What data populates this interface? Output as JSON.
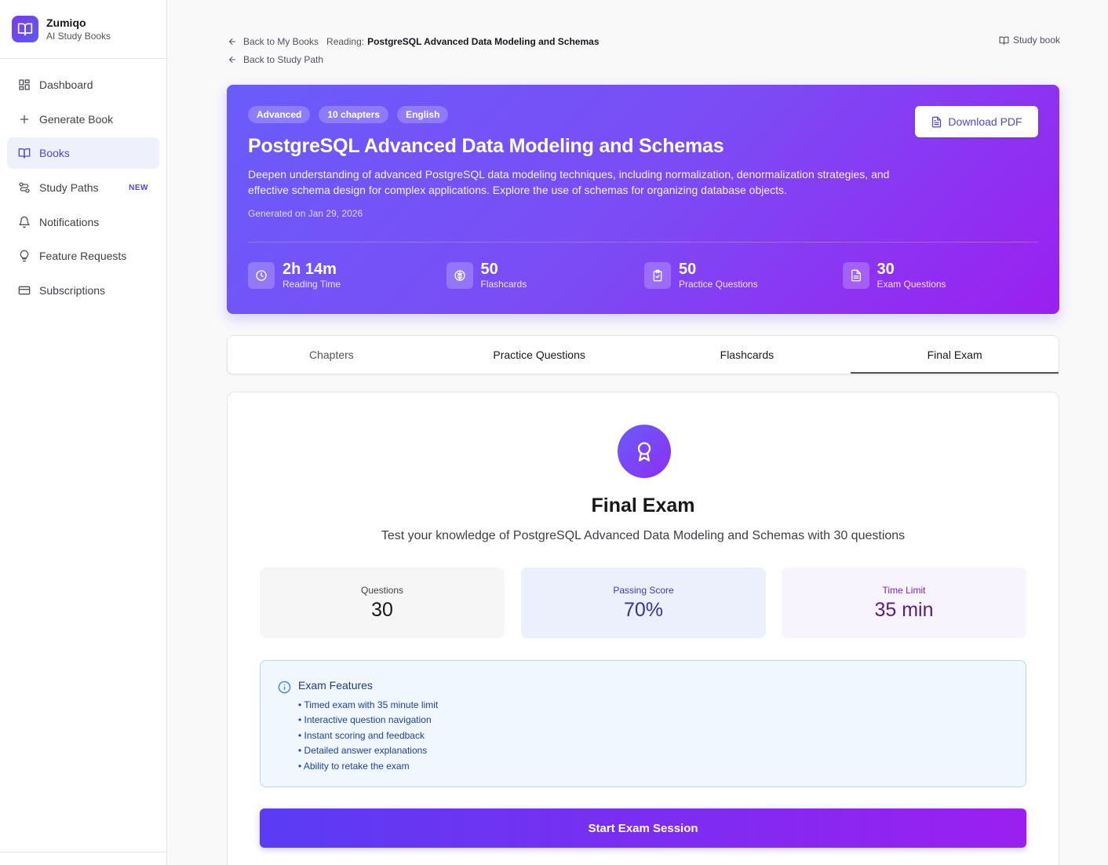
{
  "brand": {
    "name": "Zumiqo",
    "subtitle": "AI Study Books"
  },
  "sidebar": {
    "items": [
      {
        "label": "Dashboard",
        "icon": "dashboard-icon"
      },
      {
        "label": "Generate Book",
        "icon": "plus-icon"
      },
      {
        "label": "Books",
        "icon": "book-open-icon",
        "active": true
      },
      {
        "label": "Study Paths",
        "icon": "route-icon",
        "badge": "NEW"
      },
      {
        "label": "Notifications",
        "icon": "bell-icon"
      },
      {
        "label": "Feature Requests",
        "icon": "lightbulb-icon"
      },
      {
        "label": "Subscriptions",
        "icon": "credit-card-icon"
      }
    ]
  },
  "breadcrumbs": {
    "back_to_books": "Back to My Books",
    "reading_label": "Reading:",
    "book_name": "PostgreSQL Advanced Data Modeling and Schemas",
    "back_to_path": "Back to Study Path",
    "study_book": "Study book"
  },
  "hero": {
    "tags": [
      "Advanced",
      "10 chapters",
      "English"
    ],
    "title": "PostgreSQL Advanced Data Modeling and Schemas",
    "description": "Deepen understanding of advanced PostgreSQL data modeling techniques, including normalization, denormalization strategies, and effective schema design for complex applications. Explore the use of schemas for organizing database objects.",
    "generated": "Generated on Jan 29, 2026",
    "download_label": "Download PDF",
    "stats": [
      {
        "value": "2h 14m",
        "label": "Reading Time",
        "icon": "clock-icon"
      },
      {
        "value": "50",
        "label": "Flashcards",
        "icon": "brain-icon"
      },
      {
        "value": "50",
        "label": "Practice Questions",
        "icon": "clipboard-check-icon"
      },
      {
        "value": "30",
        "label": "Exam Questions",
        "icon": "file-text-icon"
      }
    ]
  },
  "tabs": [
    {
      "label": "Chapters"
    },
    {
      "label": "Practice Questions"
    },
    {
      "label": "Flashcards"
    },
    {
      "label": "Final Exam",
      "active": true
    }
  ],
  "exam": {
    "title": "Final Exam",
    "subtitle": "Test your knowledge of PostgreSQL Advanced Data Modeling and Schemas with 30 questions",
    "metrics": [
      {
        "label": "Questions",
        "value": "30"
      },
      {
        "label": "Passing Score",
        "value": "70%"
      },
      {
        "label": "Time Limit",
        "value": "35 min"
      }
    ],
    "features_title": "Exam Features",
    "features": [
      "• Timed exam with 35 minute limit",
      "• Interactive question navigation",
      "• Instant scoring and feedback",
      "• Detailed answer explanations",
      "• Ability to retake the exam"
    ],
    "start_label": "Start Exam Session"
  },
  "colors": {
    "accent": "#4f46e5",
    "hero_start": "#6a5cfb",
    "hero_end": "#9b1ff0"
  }
}
